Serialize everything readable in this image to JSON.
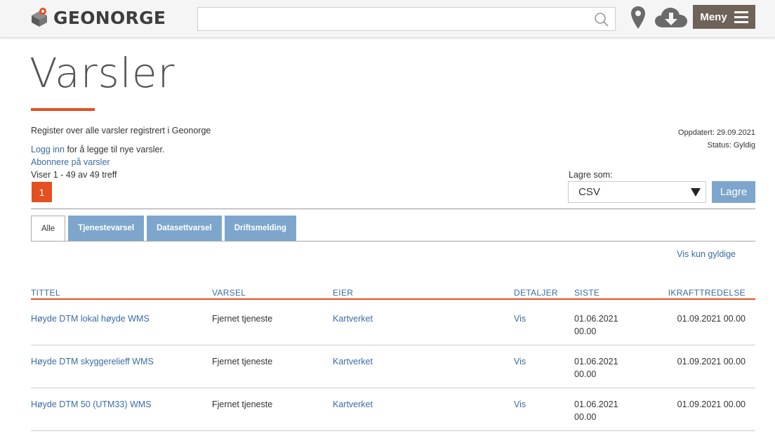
{
  "header": {
    "logo_text": "GEONORGE",
    "search_placeholder": "",
    "menu_label": "Meny"
  },
  "page": {
    "title": "Varsler",
    "description": "Register over alle varsler registrert i Geonorge",
    "login_link": "Logg inn",
    "login_suffix": " for å legge til nye varsler.",
    "subscribe_link": "Abonnere på varsler",
    "result_count": "Viser 1 - 49 av 49 treff",
    "updated": "Oppdatert: 29.09.2021",
    "status": "Status: Gyldig",
    "current_page": "1"
  },
  "export": {
    "label": "Lagre som:",
    "format": "CSV",
    "save_button": "Lagre"
  },
  "tabs": [
    {
      "label": "Alle",
      "active": true
    },
    {
      "label": "Tjenestevarsel",
      "active": false
    },
    {
      "label": "Datasettvarsel",
      "active": false
    },
    {
      "label": "Driftsmelding",
      "active": false
    }
  ],
  "filter_link": "Vis kun gyldige",
  "table": {
    "headers": [
      "TITTEL",
      "VARSEL",
      "EIER",
      "DETALJER",
      "SISTE",
      "IKRAFTTREDELSE"
    ],
    "rows": [
      {
        "title": "Høyde DTM lokal høyde WMS",
        "varsel": "Fjernet tjeneste",
        "eier": "Kartverket",
        "detaljer": "Vis",
        "siste_date": "01.06.2021",
        "siste_time": "00.00",
        "ikraft": "01.09.2021 00.00"
      },
      {
        "title": "Høyde DTM skyggerelieff WMS",
        "varsel": "Fjernet tjeneste",
        "eier": "Kartverket",
        "detaljer": "Vis",
        "siste_date": "01.06.2021",
        "siste_time": "00.00",
        "ikraft": "01.09.2021 00.00"
      },
      {
        "title": "Høyde DTM 50 (UTM33) WMS",
        "varsel": "Fjernet tjeneste",
        "eier": "Kartverket",
        "detaljer": "Vis",
        "siste_date": "01.06.2021",
        "siste_time": "00.00",
        "ikraft": "01.09.2021 00.00"
      }
    ]
  },
  "colors": {
    "accent": "#e4501e",
    "link": "#3a6aa8",
    "tab_blue": "#7ea6cc",
    "menu_brown": "#6f6258"
  },
  "icons": [
    "geonorge-logo-icon",
    "search-icon",
    "map-pin-icon",
    "download-cloud-icon",
    "hamburger-icon",
    "dropdown-caret-icon"
  ]
}
